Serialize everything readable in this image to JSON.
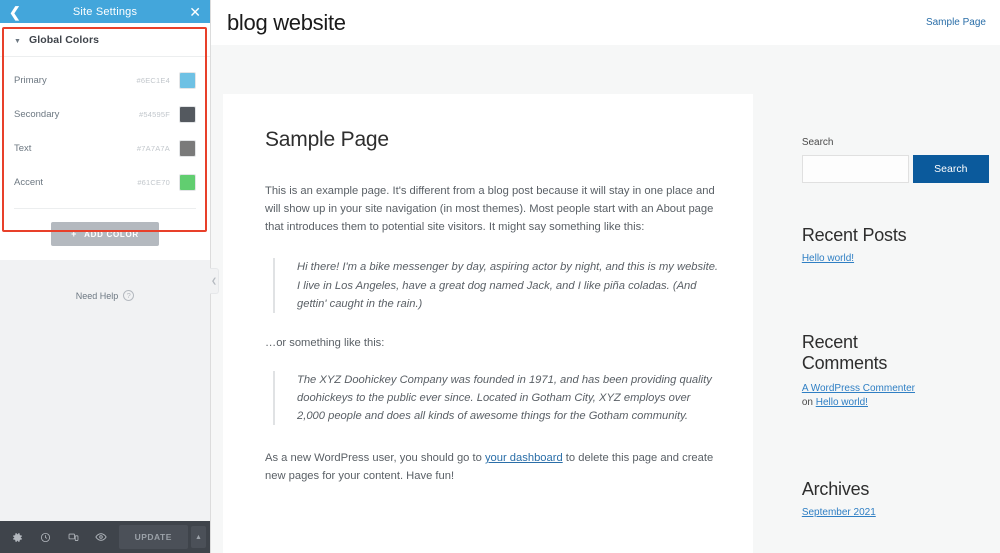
{
  "panel": {
    "header": {
      "title": "Site Settings",
      "back_icon": "chevron-left-icon",
      "close_icon": "close-icon"
    },
    "section": {
      "title": "Global Colors",
      "caret": "caret-down-icon"
    },
    "colors": [
      {
        "label": "Primary",
        "hex": "#6EC1E4",
        "swatch": "#6EC1E4"
      },
      {
        "label": "Secondary",
        "hex": "#54595F",
        "swatch": "#54595F"
      },
      {
        "label": "Text",
        "hex": "#7A7A7A",
        "swatch": "#7A7A7A"
      },
      {
        "label": "Accent",
        "hex": "#61CE70",
        "swatch": "#61CE70"
      }
    ],
    "add_color_label": "ADD COLOR",
    "add_color_plus": "+",
    "need_help": {
      "label": "Need Help",
      "icon": "question-mark-icon"
    },
    "footer": {
      "update_label": "UPDATE",
      "icons": [
        "gear-icon",
        "history-icon",
        "responsive-icon",
        "preview-icon"
      ],
      "caret": "caret-up-icon"
    },
    "collapse_handle": "collapse-panel-icon"
  },
  "site": {
    "title": "blog website",
    "nav_link": "Sample Page",
    "page_title": "Sample Page",
    "paragraph_1": "This is an example page. It's different from a blog post because it will stay in one place and will show up in your site navigation (in most themes). Most people start with an About page that introduces them to potential site visitors. It might say something like this:",
    "quote_1": "Hi there! I'm a bike messenger by day, aspiring actor by night, and this is my website. I live in Los Angeles, have a great dog named Jack, and I like piña coladas. (And gettin' caught in the rain.)",
    "interstitial": "…or something like this:",
    "quote_2": "The XYZ Doohickey Company was founded in 1971, and has been providing quality doohickeys to the public ever since. Located in Gotham City, XYZ employs over 2,000 people and does all kinds of awesome things for the Gotham community.",
    "paragraph_2_before": "As a new WordPress user, you should go to ",
    "paragraph_2_link": "your dashboard",
    "paragraph_2_after": " to delete this page and create new pages for your content. Have fun!"
  },
  "sidebar": {
    "search_label": "Search",
    "search_value": "",
    "search_placeholder": "",
    "search_button": "Search",
    "recent_posts_title": "Recent Posts",
    "recent_posts_items": [
      "Hello world!"
    ],
    "recent_comments_title": "Recent Comments",
    "recent_comment_author": "A WordPress Commenter",
    "recent_comment_on": "on ",
    "recent_comment_post": "Hello world!",
    "archives_title": "Archives",
    "archives_items": [
      "September 2021"
    ]
  }
}
